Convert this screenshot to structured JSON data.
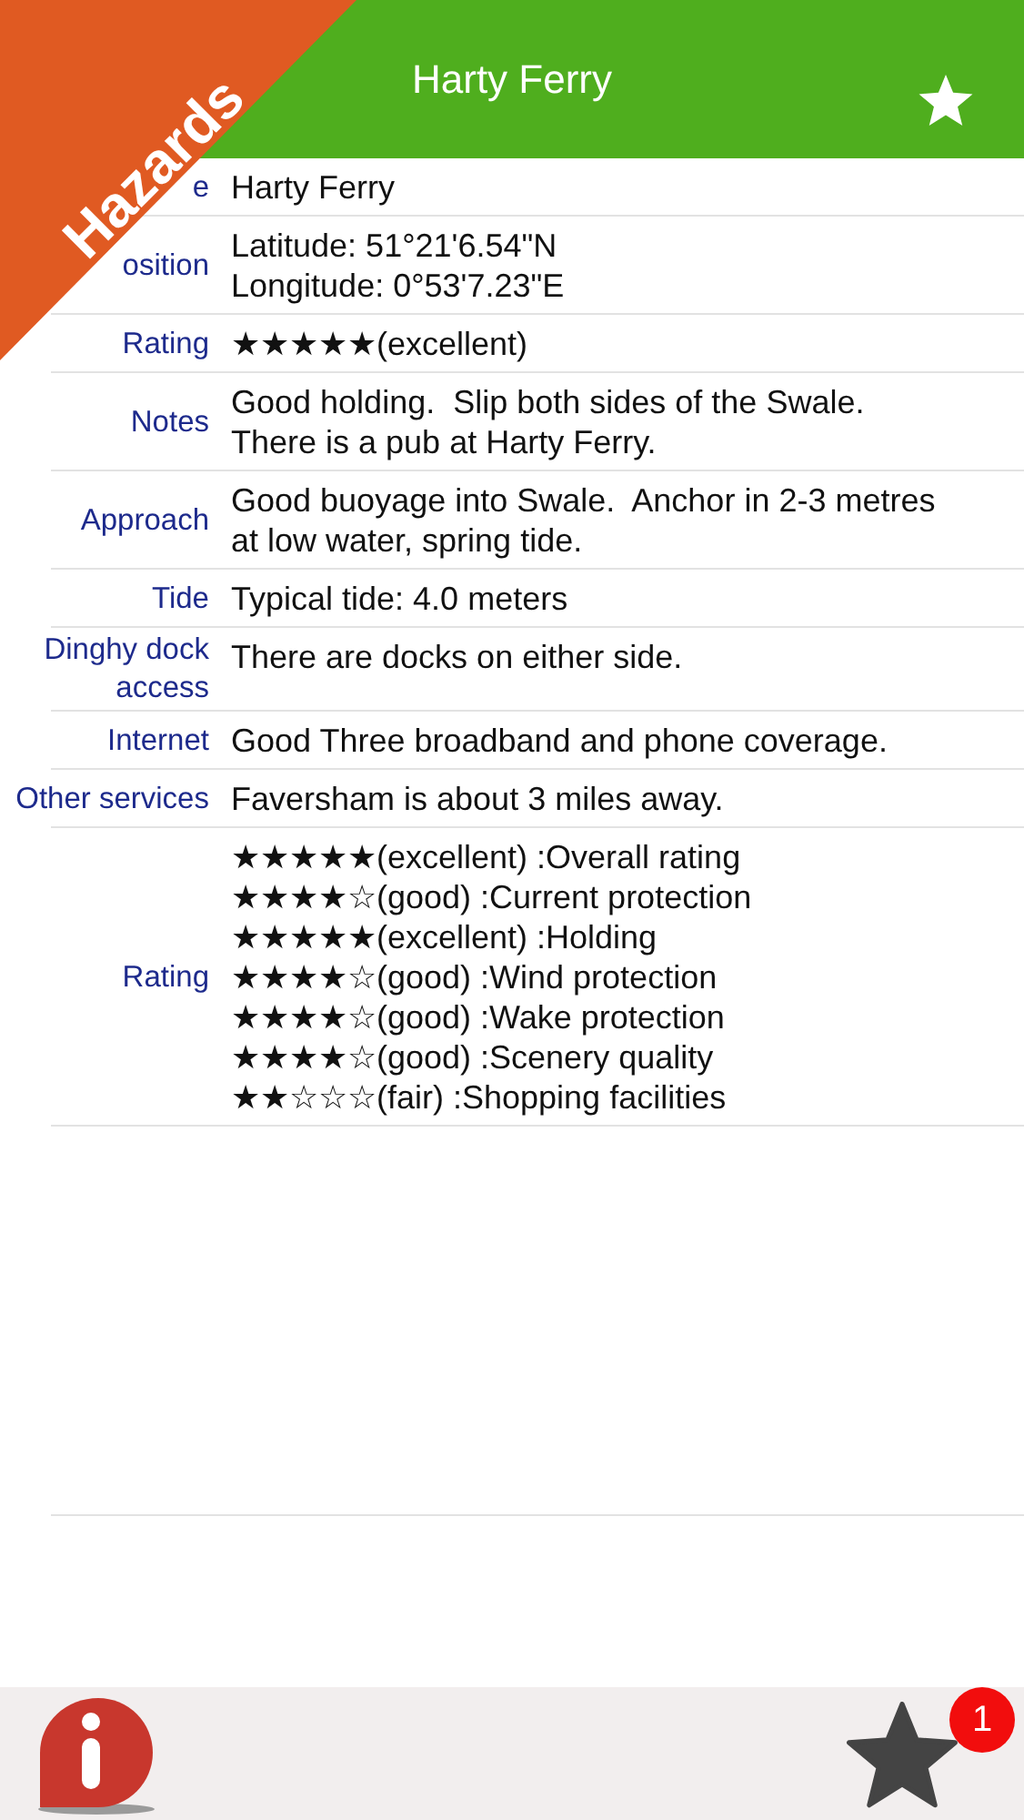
{
  "header": {
    "title": "Harty Ferry"
  },
  "ribbon": {
    "text": "Hazards"
  },
  "rows": [
    {
      "label": "e",
      "lines": [
        "Harty Ferry"
      ]
    },
    {
      "label": "osition",
      "lines": [
        "Latitude: 51°21'6.54\"N",
        "Longitude: 0°53'7.23\"E"
      ]
    },
    {
      "label": "Rating",
      "lines": [
        "★★★★★(excellent)"
      ]
    },
    {
      "label": "Notes",
      "lines": [
        "Good holding.  Slip both sides of the Swale.",
        "There is a pub at Harty Ferry."
      ]
    },
    {
      "label": "Approach",
      "lines": [
        "Good buoyage into Swale.  Anchor in 2-3 metres",
        "at low water, spring tide."
      ]
    },
    {
      "label": "Tide",
      "lines": [
        "Typical tide: 4.0 meters"
      ]
    },
    {
      "label": "Dinghy dock access",
      "lines": [
        "There are docks on either side."
      ]
    },
    {
      "label": "Internet",
      "lines": [
        "Good Three broadband and phone coverage."
      ]
    },
    {
      "label": "Other services",
      "lines": [
        "Faversham is about 3 miles away."
      ]
    },
    {
      "label": "Rating",
      "lines": [
        "★★★★★(excellent) :Overall rating",
        "★★★★☆(good) :Current protection",
        "★★★★★(excellent) :Holding",
        "★★★★☆(good) :Wind protection",
        "★★★★☆(good) :Wake protection",
        "★★★★☆(good) :Scenery quality",
        "★★☆☆☆(fair) :Shopping facilities"
      ]
    }
  ],
  "footer": {
    "badge": "1"
  }
}
